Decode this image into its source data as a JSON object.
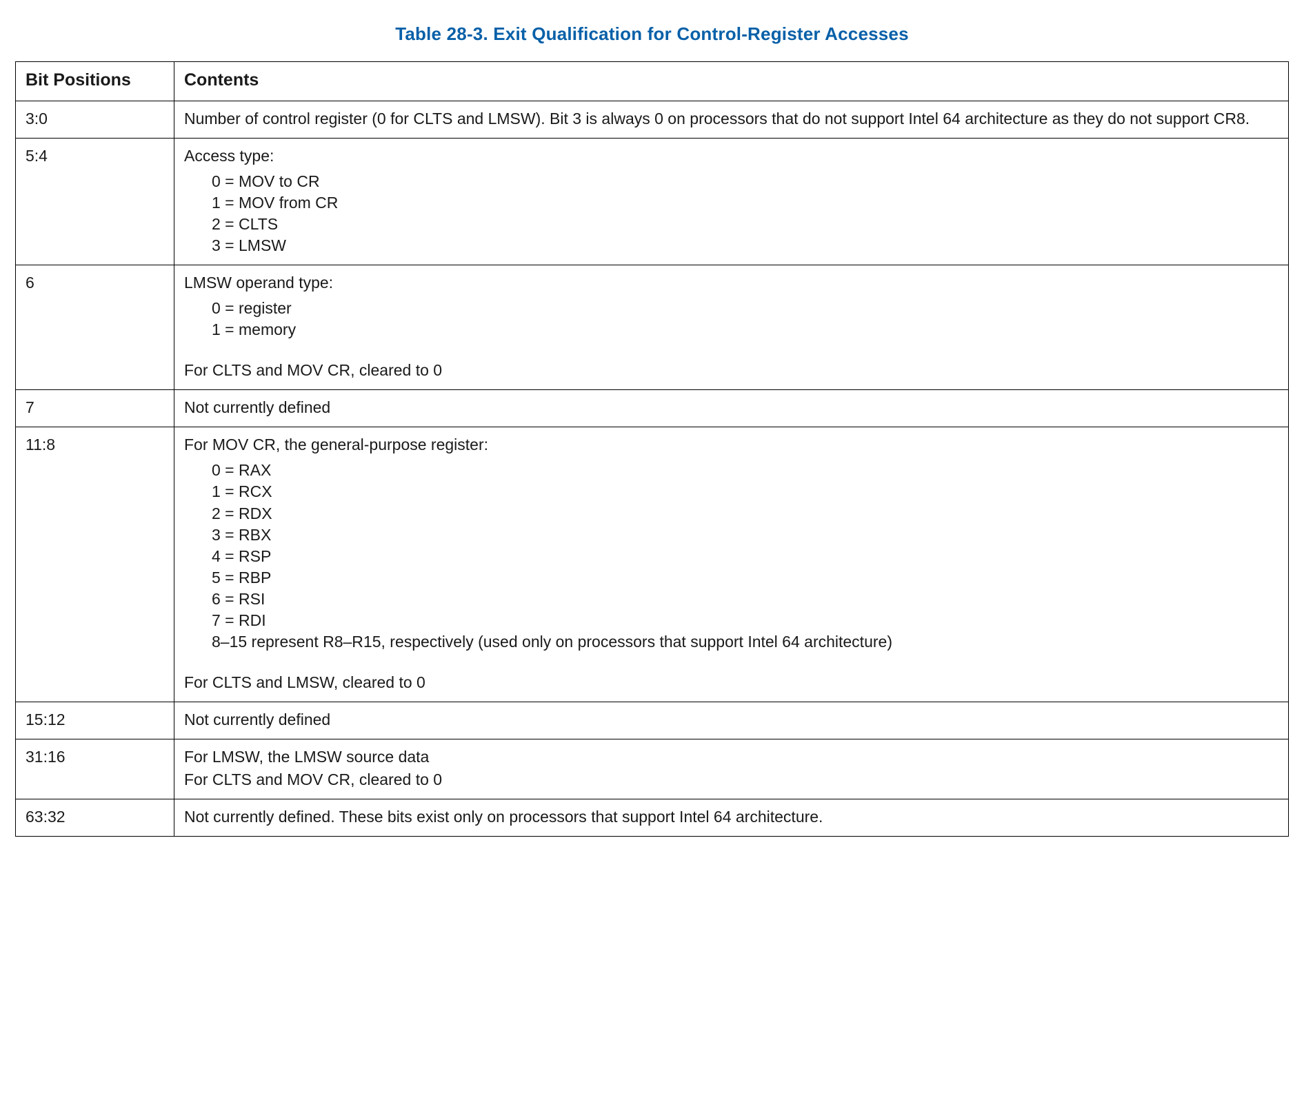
{
  "caption": "Table 28-3.  Exit Qualification for Control-Register Accesses",
  "headers": {
    "bit": "Bit Positions",
    "contents": "Contents"
  },
  "rows": {
    "r0": {
      "bit": "3:0",
      "text": "Number of control register (0 for CLTS and LMSW). Bit 3 is always 0 on processors that do not support Intel 64 architecture as they do not support CR8."
    },
    "r1": {
      "bit": "5:4",
      "intro": "Access type:",
      "items": {
        "i0": "0 = MOV to CR",
        "i1": "1 = MOV from CR",
        "i2": "2 = CLTS",
        "i3": "3 = LMSW"
      }
    },
    "r2": {
      "bit": "6",
      "intro": "LMSW operand type:",
      "items": {
        "i0": "0 = register",
        "i1": "1 = memory"
      },
      "trail": "For CLTS and MOV CR, cleared to 0"
    },
    "r3": {
      "bit": "7",
      "text": "Not currently defined"
    },
    "r4": {
      "bit": "11:8",
      "intro": "For MOV CR, the general-purpose register:",
      "items": {
        "i0": "0 = RAX",
        "i1": "1 = RCX",
        "i2": "2 = RDX",
        "i3": "3 = RBX",
        "i4": "4 = RSP",
        "i5": "5 = RBP",
        "i6": "6 = RSI",
        "i7": "7 = RDI",
        "i8": "8–15 represent R8–R15, respectively (used only on processors that support Intel 64 architecture)"
      },
      "trail": "For CLTS and LMSW, cleared to 0"
    },
    "r5": {
      "bit": "15:12",
      "text": "Not currently defined"
    },
    "r6": {
      "bit": "31:16",
      "line1": "For LMSW, the LMSW source data",
      "line2": "For CLTS and MOV CR, cleared to 0"
    },
    "r7": {
      "bit": "63:32",
      "text": "Not currently defined. These bits exist only on processors that support Intel 64 architecture."
    }
  }
}
